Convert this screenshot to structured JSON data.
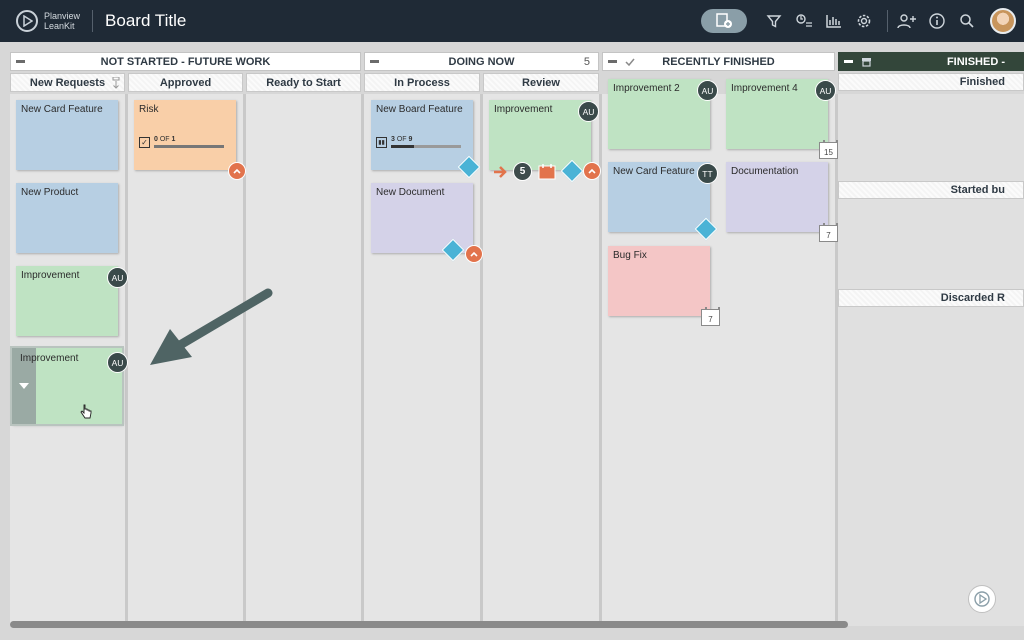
{
  "app": {
    "logo_line1": "Planview",
    "logo_line2": "LeanKit",
    "board_title": "Board Title"
  },
  "toolbar": {
    "icons": [
      "new-card-icon",
      "filter-icon",
      "board-filter-icon",
      "analytics-icon",
      "settings-icon",
      "add-user-icon",
      "info-icon",
      "search-icon",
      "user-avatar"
    ]
  },
  "lanes": {
    "not_started": "NOT STARTED - FUTURE WORK",
    "doing_now": "DOING NOW",
    "doing_now_wip": "5",
    "recently_finished": "RECENTLY FINISHED",
    "finished": "FINISHED -"
  },
  "columns": {
    "new_requests": "New Requests",
    "approved": "Approved",
    "ready_to_start": "Ready to Start",
    "in_process": "In Process",
    "review": "Review",
    "finished_sub": "Finished",
    "started_sub": "Started bu",
    "discarded_sub": "Discarded R"
  },
  "cards": {
    "new_card_feature_1": "New Card Feature",
    "new_product": "New Product",
    "improvement_1": "Improvement",
    "improvement_1_avatar": "AU",
    "improvement_2": "Improvement",
    "improvement_2_avatar": "AU",
    "risk": "Risk",
    "risk_progress_done": "0",
    "risk_progress_of": "OF",
    "risk_progress_total": "1",
    "risk_progress_fraction": 0,
    "new_board_feature": "New Board Feature",
    "nbf_progress_done": "3",
    "nbf_progress_of": "OF",
    "nbf_progress_total": "9",
    "nbf_progress_fraction": 0.33,
    "new_document": "New Document",
    "improvement_review": "Improvement",
    "improvement_review_avatar": "AU",
    "review_count_badge": "5",
    "improvement_2b": "Improvement 2",
    "improvement_2b_avatar": "AU",
    "improvement_4": "Improvement 4",
    "improvement_4_avatar": "AU",
    "improvement_4_date": "15",
    "new_card_feature_2": "New Card Feature",
    "new_card_feature_2_avatar": "TT",
    "documentation": "Documentation",
    "documentation_date": "7",
    "bug_fix": "Bug Fix",
    "bug_fix_date": "7"
  },
  "colors": {
    "topbar": "#1f2a36",
    "blue_card": "#b7cfe3",
    "green_card": "#bfe3c3",
    "orange_card": "#f9cfa8",
    "purple_card": "#d4d2e8",
    "pink_card": "#f4c6c6",
    "blocked": "#e2734c",
    "tag": "#4ab3d6",
    "arrow": "#4f6464"
  }
}
